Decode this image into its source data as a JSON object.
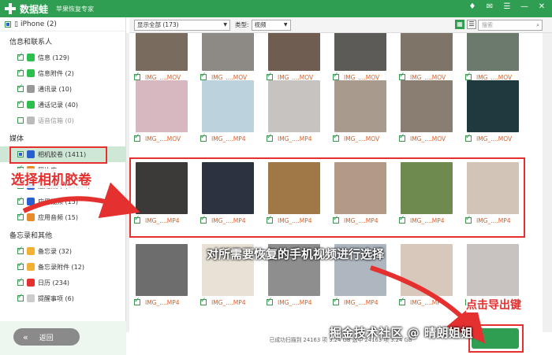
{
  "app": {
    "name": "数据蛙",
    "slogan": "苹果恢复专家"
  },
  "window_controls": [
    "♦",
    "✉",
    "☰",
    "—",
    "✕"
  ],
  "device": {
    "label": "iPhone (2)"
  },
  "sidebar": {
    "groups": [
      {
        "title": "信息和联系人",
        "items": [
          {
            "label": "信息 (129)",
            "checked": true,
            "icon": "message-icon",
            "color": "#2fbf4f"
          },
          {
            "label": "信息附件 (2)",
            "checked": true,
            "icon": "attachment-icon",
            "color": "#2fbf4f"
          },
          {
            "label": "通讯录 (10)",
            "checked": true,
            "icon": "contacts-icon",
            "color": "#999999"
          },
          {
            "label": "通话记录 (40)",
            "checked": true,
            "icon": "phone-icon",
            "color": "#2fbf4f"
          },
          {
            "label": "语音信箱 (0)",
            "checked": false,
            "icon": "voicemail-icon",
            "color": "#bbbbbb",
            "disabled": true
          }
        ]
      },
      {
        "title": "媒体",
        "items": [
          {
            "label": "相机胶卷 (1411)",
            "checked": "partial",
            "icon": "camera-roll-icon",
            "color": "#2a5fd0",
            "selected": true
          },
          {
            "label": "照片库",
            "checked": true,
            "icon": "photo-library-icon",
            "color": "#e98a2b"
          },
          {
            "label": "应用照片 (13644)",
            "checked": true,
            "icon": "app-photos-icon",
            "color": "#2a5fd0"
          },
          {
            "label": "应用视频 (15)",
            "checked": true,
            "icon": "app-video-icon",
            "color": "#2a5fd0"
          },
          {
            "label": "应用音频 (15)",
            "checked": true,
            "icon": "app-audio-icon",
            "color": "#e98a2b"
          }
        ]
      },
      {
        "title": "备忘录和其他",
        "items": [
          {
            "label": "备忘录 (32)",
            "checked": true,
            "icon": "notes-icon",
            "color": "#f2b134"
          },
          {
            "label": "备忘录附件 (12)",
            "checked": true,
            "icon": "notes-attach-icon",
            "color": "#f2b134"
          },
          {
            "label": "日历 (234)",
            "checked": true,
            "icon": "calendar-icon",
            "color": "#e53030"
          },
          {
            "label": "提醒事项 (6)",
            "checked": true,
            "icon": "reminder-icon",
            "color": "#cccccc"
          }
        ]
      }
    ],
    "back_label": "返回"
  },
  "toolbar": {
    "filter_value": "显示全部 (173)",
    "type_label": "类型:",
    "type_value": "视频",
    "search_placeholder": "搜索"
  },
  "files": {
    "rows": [
      [
        "IMG_....MOV",
        "IMG_....MOV",
        "IMG_....MOV",
        "IMG_....MOV",
        "IMG_....MOV",
        "IMG_....MOV"
      ],
      [
        "IMG_....MOV",
        "IMG_....MP4",
        "IMG_....MP4",
        "IMG_....MOV",
        "IMG_....MOV",
        "IMG_....MOV"
      ],
      [
        "IMG_....MP4",
        "IMG_....MP4",
        "IMG_....MP4",
        "IMG_....MP4",
        "IMG_....MP4",
        "IMG_....MP4"
      ],
      [
        "IMG_....MP4",
        "IMG_....MP4",
        "IMG_....MP4",
        "IMG_....MP4",
        "IMG_....MP4",
        "IMG_....MP4"
      ]
    ],
    "thumb_colors": [
      [
        "#7a6b5f",
        "#8d8a86",
        "#6f5d52",
        "#5c5b58",
        "#7e7468",
        "#6b7a6d"
      ],
      [
        "#d8b8c0",
        "#bcd3dd",
        "#c7c3c0",
        "#a99a8e",
        "#8a7e72",
        "#1f3a3f"
      ],
      [
        "#3b3a38",
        "#2c3340",
        "#a07848",
        "#b29a86",
        "#6e8a4e",
        "#d2c5b8"
      ],
      [
        "#6d6d6d",
        "#e8e2d6",
        "#8e8e8e",
        "#aeb6c0",
        "#d8c8bc",
        "#c8c2c0"
      ]
    ]
  },
  "status": {
    "text": "已成功扫描到 24163 项 3.24 GB    选中 24163 项 3.24 GB"
  },
  "annotations": {
    "select_camera_roll": "选择相机胶卷",
    "select_videos": "对所需要恢复的手机视频进行选择",
    "click_export": "点击导出键"
  },
  "watermark": "掘金技术社区 @ 晴朗姐姐"
}
